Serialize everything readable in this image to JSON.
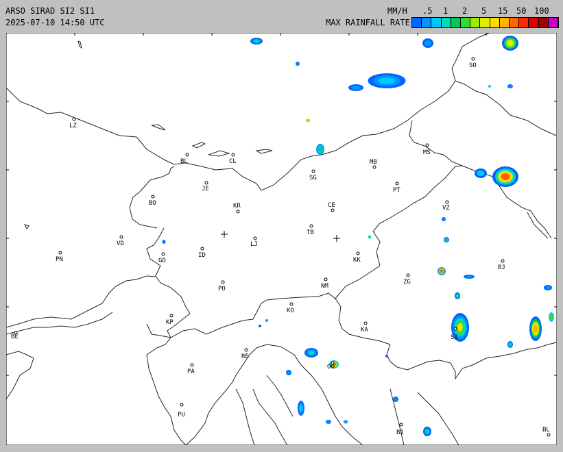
{
  "header": {
    "title": "ARSO SIRAD SI2 SI1",
    "timestamp": "2025-07-10 14:50 UTC",
    "units": "MM/H",
    "legend_title": "MAX RAINFALL RATE"
  },
  "scale": {
    "ticks": [
      ".5",
      "1",
      "2",
      "5",
      "15",
      "50",
      "100"
    ],
    "colors": [
      "#0064ff",
      "#0096ff",
      "#00c8ff",
      "#00dcb4",
      "#00c850",
      "#32dc32",
      "#96f000",
      "#dcf000",
      "#ffdc00",
      "#ffb400",
      "#ff6400",
      "#ff2800",
      "#dc0000",
      "#a00000",
      "#c800c8"
    ]
  },
  "places": [
    {
      "code": "LZ"
    },
    {
      "code": "BL"
    },
    {
      "code": "CL"
    },
    {
      "code": "SG"
    },
    {
      "code": "MB"
    },
    {
      "code": "MS"
    },
    {
      "code": "SO"
    },
    {
      "code": "PT"
    },
    {
      "code": "JE"
    },
    {
      "code": "BO"
    },
    {
      "code": "KR"
    },
    {
      "code": "CE"
    },
    {
      "code": "VZ"
    },
    {
      "code": "TB"
    },
    {
      "code": "VD"
    },
    {
      "code": "LJ"
    },
    {
      "code": "PN"
    },
    {
      "code": "ID"
    },
    {
      "code": "GO"
    },
    {
      "code": "KK"
    },
    {
      "code": "BJ"
    },
    {
      "code": "ZG"
    },
    {
      "code": "PO"
    },
    {
      "code": "NM"
    },
    {
      "code": "KO"
    },
    {
      "code": "KP"
    },
    {
      "code": "KA"
    },
    {
      "code": "BE"
    },
    {
      "code": "SI"
    },
    {
      "code": "RE"
    },
    {
      "code": "PA"
    },
    {
      "code": "OG"
    },
    {
      "code": "PU"
    },
    {
      "code": "BI"
    },
    {
      "code": "BL"
    }
  ]
}
